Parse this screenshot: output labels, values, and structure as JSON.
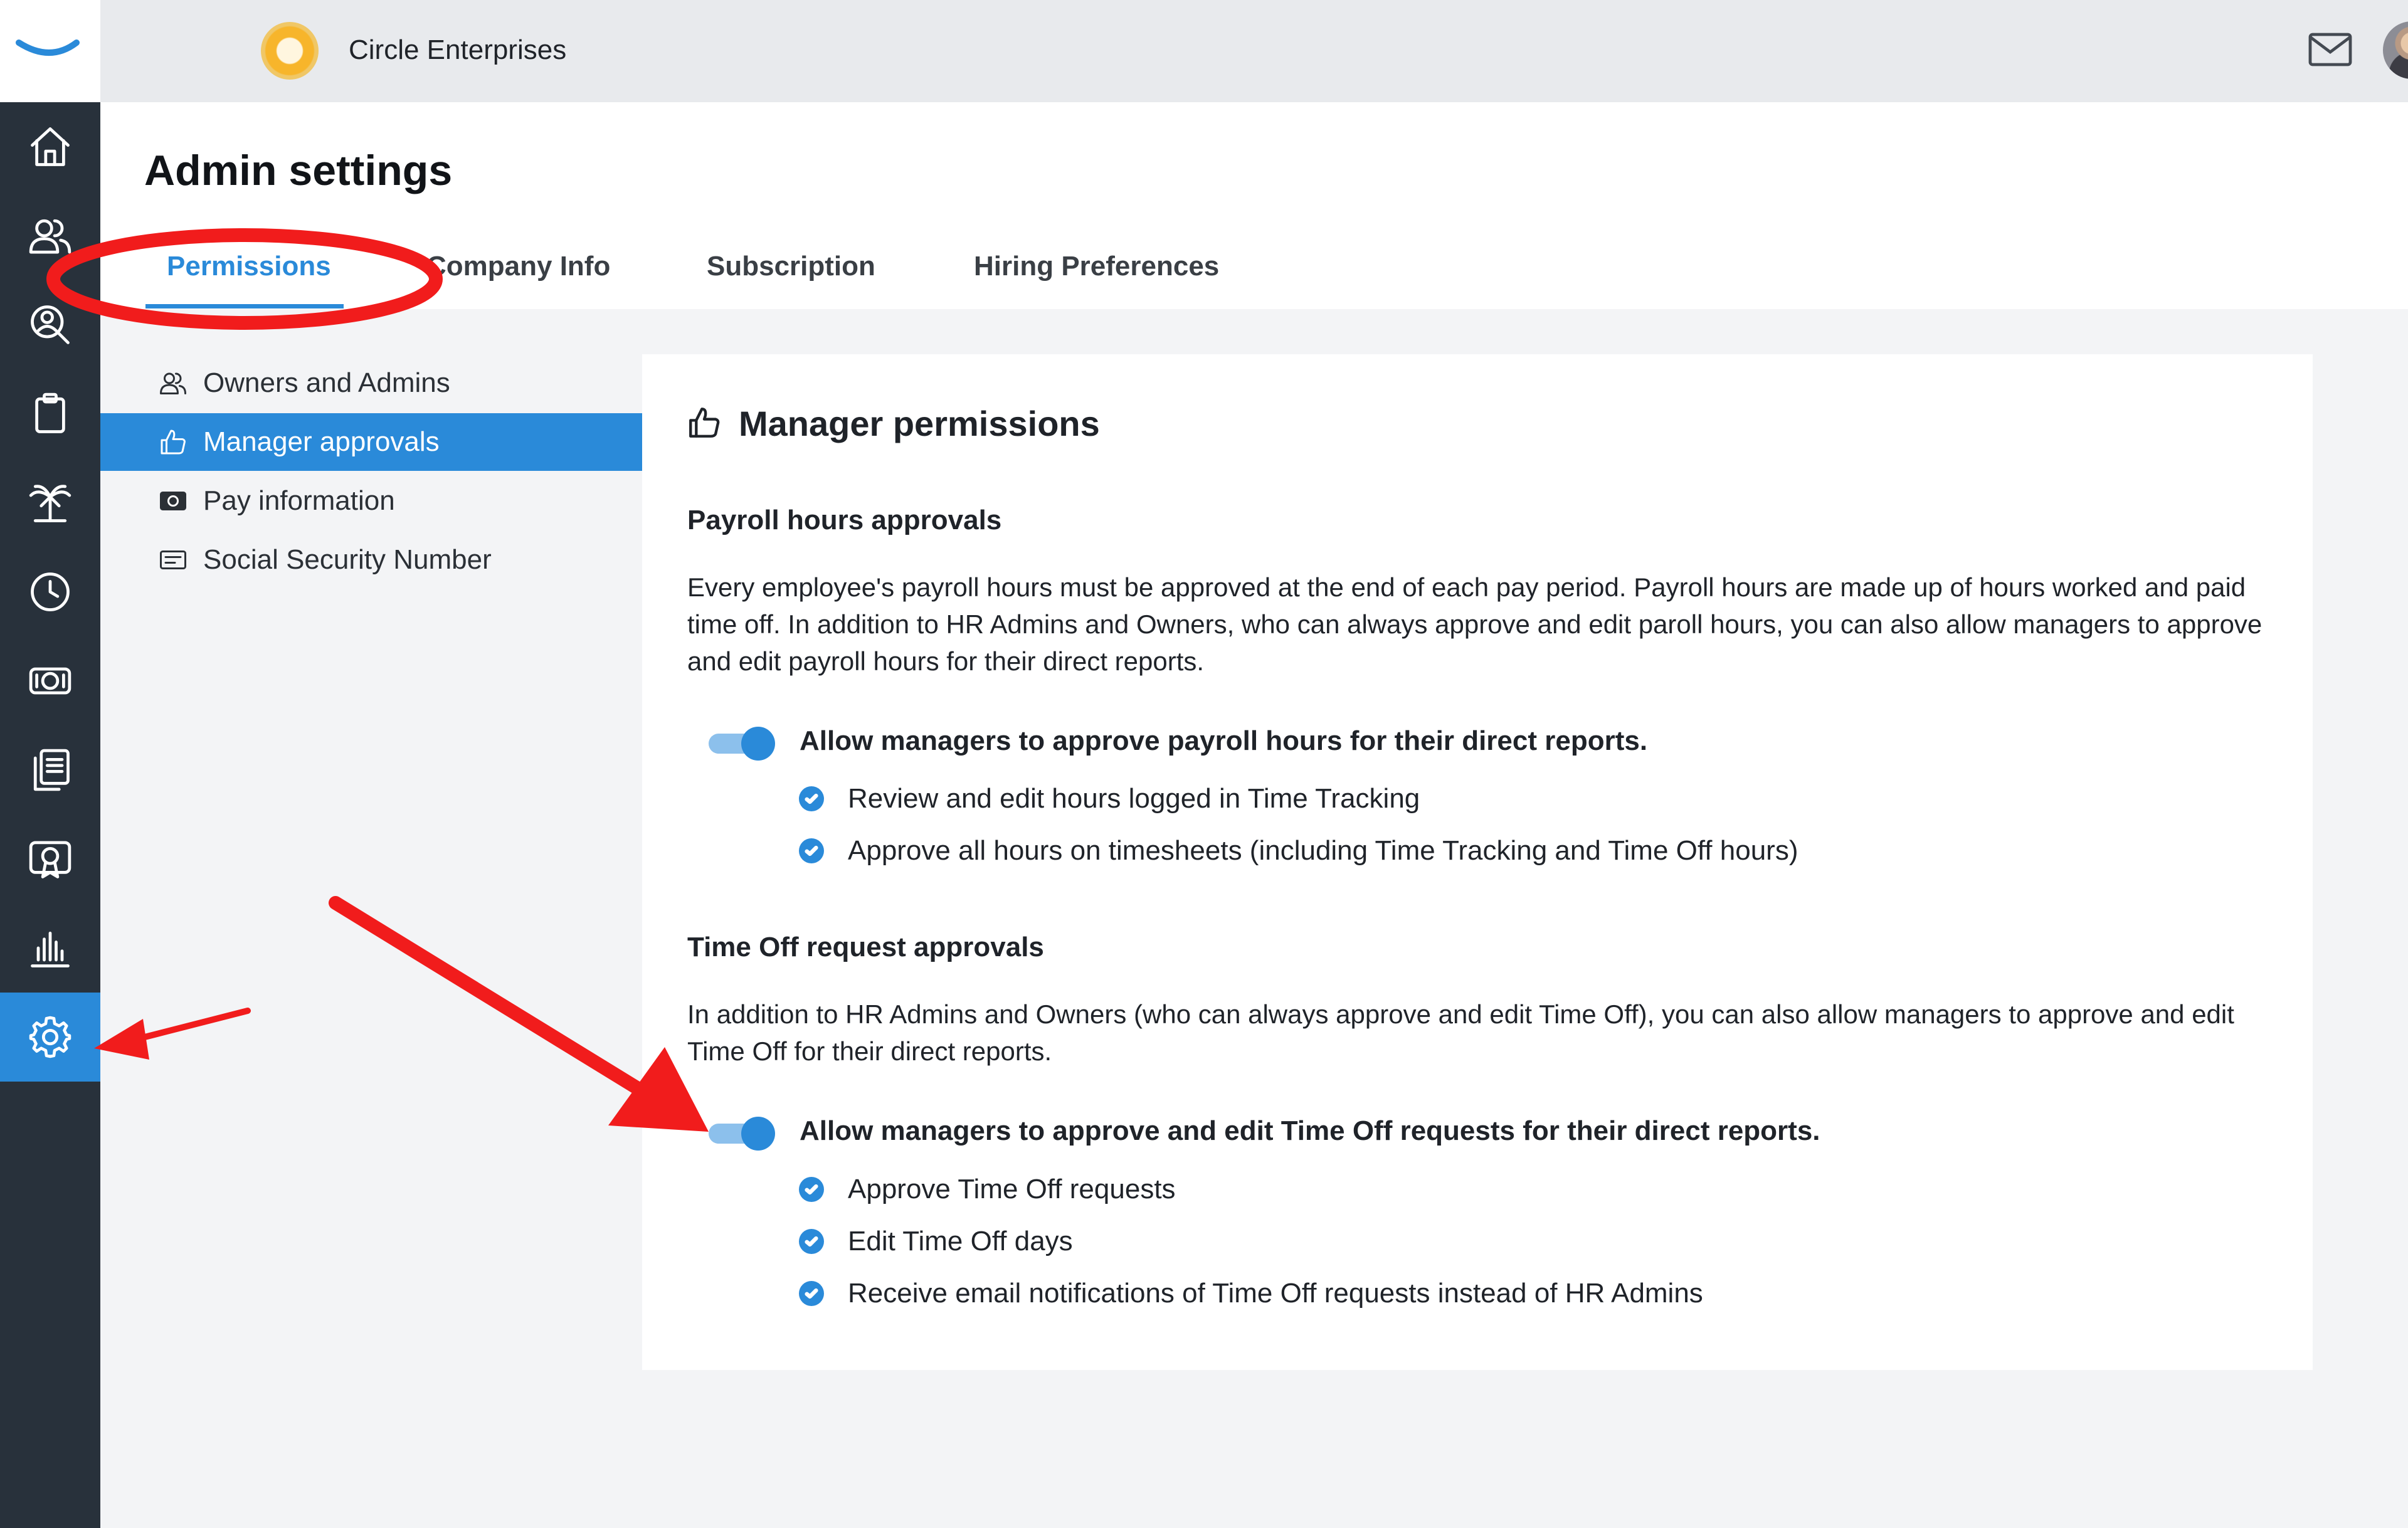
{
  "company": {
    "name": "Circle Enterprises"
  },
  "page": {
    "title": "Admin settings"
  },
  "tabs": [
    {
      "label": "Permissions",
      "active": true
    },
    {
      "label": "Company Info",
      "active": false
    },
    {
      "label": "Subscription",
      "active": false
    },
    {
      "label": "Hiring Preferences",
      "active": false
    }
  ],
  "rail": {
    "icons": [
      "home-icon",
      "people-icon",
      "search-person-icon",
      "clipboard-icon",
      "palm-tree-icon",
      "clock-icon",
      "money-icon",
      "documents-icon",
      "certificate-icon",
      "bar-chart-icon",
      "gear-icon"
    ],
    "active": "gear-icon"
  },
  "subnav": [
    {
      "label": "Owners and Admins",
      "icon": "people-icon",
      "active": false
    },
    {
      "label": "Manager approvals",
      "icon": "thumbs-up-icon",
      "active": true
    },
    {
      "label": "Pay information",
      "icon": "money-icon",
      "active": false
    },
    {
      "label": "Social Security Number",
      "icon": "id-card-icon",
      "active": false
    }
  ],
  "card": {
    "title": "Manager permissions",
    "payroll": {
      "title": "Payroll hours approvals",
      "description": "Every employee's payroll hours must be approved at the end of each pay period. Payroll hours are made up of hours worked and paid time off. In addition to HR Admins and Owners, who can always approve and edit paroll hours, you can also allow managers to approve and edit payroll hours for their direct reports.",
      "toggle_label": "Allow managers to approve payroll hours for their direct reports.",
      "toggle_on": true,
      "items": [
        "Review and edit hours logged in Time Tracking",
        "Approve all hours on timesheets (including Time Tracking and Time Off hours)"
      ]
    },
    "timeoff": {
      "title": "Time Off request approvals",
      "description": "In addition to HR Admins and Owners (who can always approve and edit Time Off), you can also allow managers to approve and edit Time Off for their direct reports.",
      "toggle_label": "Allow managers to approve and edit Time Off requests for their direct reports.",
      "toggle_on": true,
      "items": [
        "Approve Time Off requests",
        "Edit Time Off days",
        "Receive email notifications of Time Off requests instead of HR Admins"
      ]
    }
  },
  "colors": {
    "accent": "#2a8ad9",
    "rail": "#28313b",
    "annotation": "#f11c1c"
  }
}
